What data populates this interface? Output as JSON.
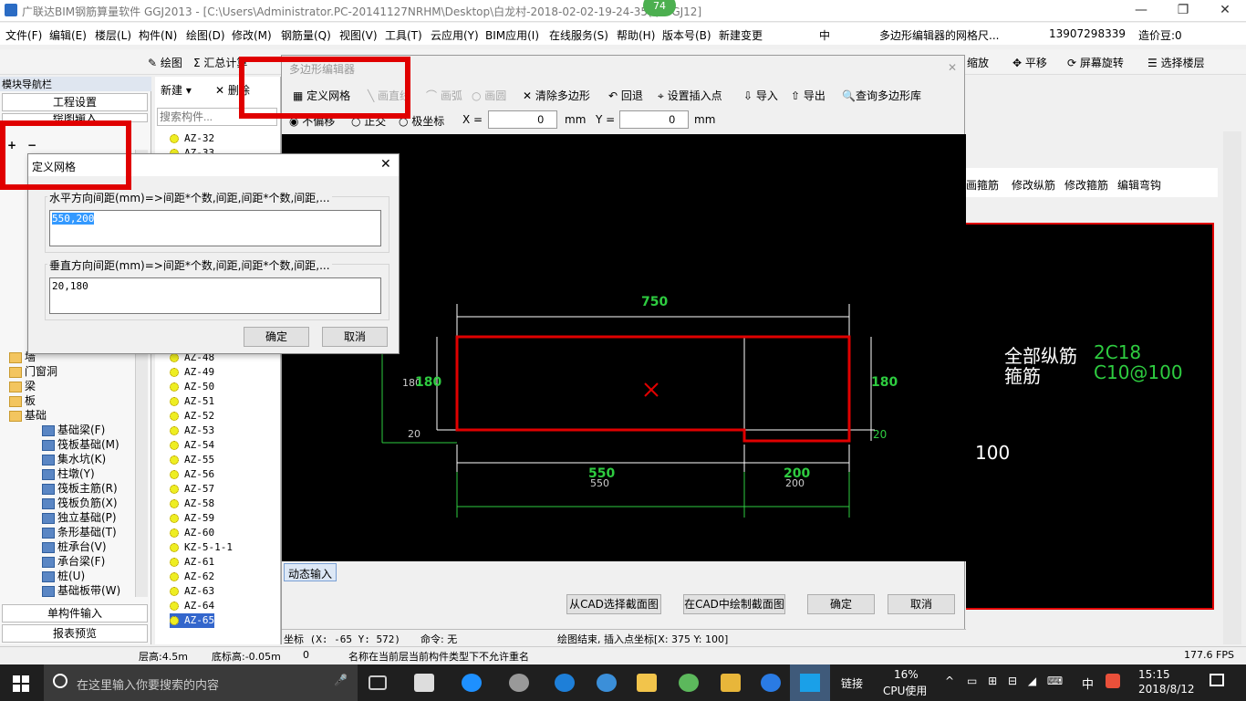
{
  "window": {
    "title": "广联达BIM钢筋算量软件 GGJ2013 - [C:\\Users\\Administrator.PC-20141127NRHM\\Desktop\\白龙村-2018-02-02-19-24-35(          ).GGJ12]",
    "badge": "74"
  },
  "menu": [
    "文件(F)",
    "编辑(E)",
    "楼层(L)",
    "构件(N)",
    "绘图(D)",
    "修改(M)",
    "钢筋量(Q)",
    "视图(V)",
    "工具(T)",
    "云应用(Y)",
    "BIM应用(I)",
    "在线服务(S)",
    "帮助(H)",
    "版本号(B)",
    "新建变更"
  ],
  "menu_right": {
    "phone": "13907298339",
    "price": "造价豆:0",
    "ime": "中",
    "search_hint": "多边形编辑器的网格尺..."
  },
  "toolbar": {
    "draw": "绘图",
    "sum": "汇总计算",
    "zoom": "缩放",
    "pan": "平移",
    "rotate": "屏幕旋转",
    "select_floor": "选择楼层"
  },
  "nav": {
    "header": "模块导航栏",
    "pin": "ф ×",
    "project_settings": "工程设置",
    "draw_input": "绘图输入",
    "single_input": "单构件输入",
    "report": "报表预览"
  },
  "tree": {
    "wall": "墙",
    "door": "门窗洞",
    "beam": "梁",
    "slab": "板",
    "foundation": "基础",
    "children": [
      "基础梁(F)",
      "筏板基础(M)",
      "集水坑(K)",
      "柱墩(Y)",
      "筏板主筋(R)",
      "筏板负筋(X)",
      "独立基础(P)",
      "条形基础(T)",
      "桩承台(V)",
      "承台梁(F)",
      "桩(U)",
      "基础板带(W)"
    ]
  },
  "comp": {
    "new": "新建",
    "delete": "删除",
    "search_placeholder": "搜索构件...",
    "items": [
      "AZ-32",
      "AZ-33",
      "AZ-48",
      "AZ-49",
      "AZ-50",
      "AZ-51",
      "AZ-52",
      "AZ-53",
      "AZ-54",
      "AZ-55",
      "AZ-56",
      "AZ-57",
      "AZ-58",
      "AZ-59",
      "AZ-60",
      "KZ-5-1-1",
      "AZ-61",
      "AZ-62",
      "AZ-63",
      "AZ-64",
      "AZ-65"
    ]
  },
  "poly": {
    "title": "多边形编辑器",
    "define_grid": "定义网格",
    "draw_line": "画直线",
    "draw_arc": "画弧",
    "draw_circle": "画圆",
    "clear": "清除多边形",
    "undo": "回退",
    "set_insert": "设置插入点",
    "import": "导入",
    "export": "导出",
    "query": "查询多边形库",
    "no_offset": "不偏移",
    "ortho": "正交",
    "polar": "极坐标",
    "x_label": "X =",
    "x_value": "0",
    "y_label": "Y =",
    "y_value": "0",
    "unit": "mm",
    "dynamic_input": "动态输入",
    "from_cad": "从CAD选择截面图",
    "draw_in_cad": "在CAD中绘制截面图",
    "ok": "确定",
    "cancel": "取消",
    "coord": "坐标 (X: -65 Y: 572)",
    "cmd": "命令: 无",
    "status": "绘图结束, 插入点坐标[X: 375 Y: 100]"
  },
  "dims": {
    "top": "750",
    "left_g": "180",
    "left_w": "180",
    "left_small": "20",
    "right_g": "180",
    "right_small": "20",
    "bottom_g1": "550",
    "bottom_w1": "550",
    "bottom_g2": "200",
    "bottom_w2": "200"
  },
  "grid_dlg": {
    "title": "定义网格",
    "h_label": "水平方向间距(mm)=>间距*个数,间距,间距*个数,间距,...",
    "h_value": "550,200",
    "v_label": "垂直方向间距(mm)=>间距*个数,间距,间距*个数,间距,...",
    "v_value": "20,180",
    "ok": "确定",
    "cancel": "取消"
  },
  "right": {
    "draw_stirrup": "画箍筋",
    "edit_long": "修改纵筋",
    "edit_stirrup": "修改箍筋",
    "edit_hook": "编辑弯钩",
    "all_long": "全部纵筋",
    "all_long_v": "2C18",
    "stirrup": "箍筋",
    "stirrup_v": "C10@100",
    "dim100": "100"
  },
  "status": {
    "floor_h": "层高:4.5m",
    "base_h": "底标高:-0.05m",
    "zero": "0",
    "msg": "名称在当前层当前构件类型下不允许重名",
    "fps": "177.6 FPS"
  },
  "taskbar": {
    "search": "在这里输入你要搜索的内容",
    "link": "链接",
    "cpu_pct": "16%",
    "cpu": "CPU使用",
    "ime": "中",
    "time": "15:15",
    "date": "2018/8/12"
  }
}
